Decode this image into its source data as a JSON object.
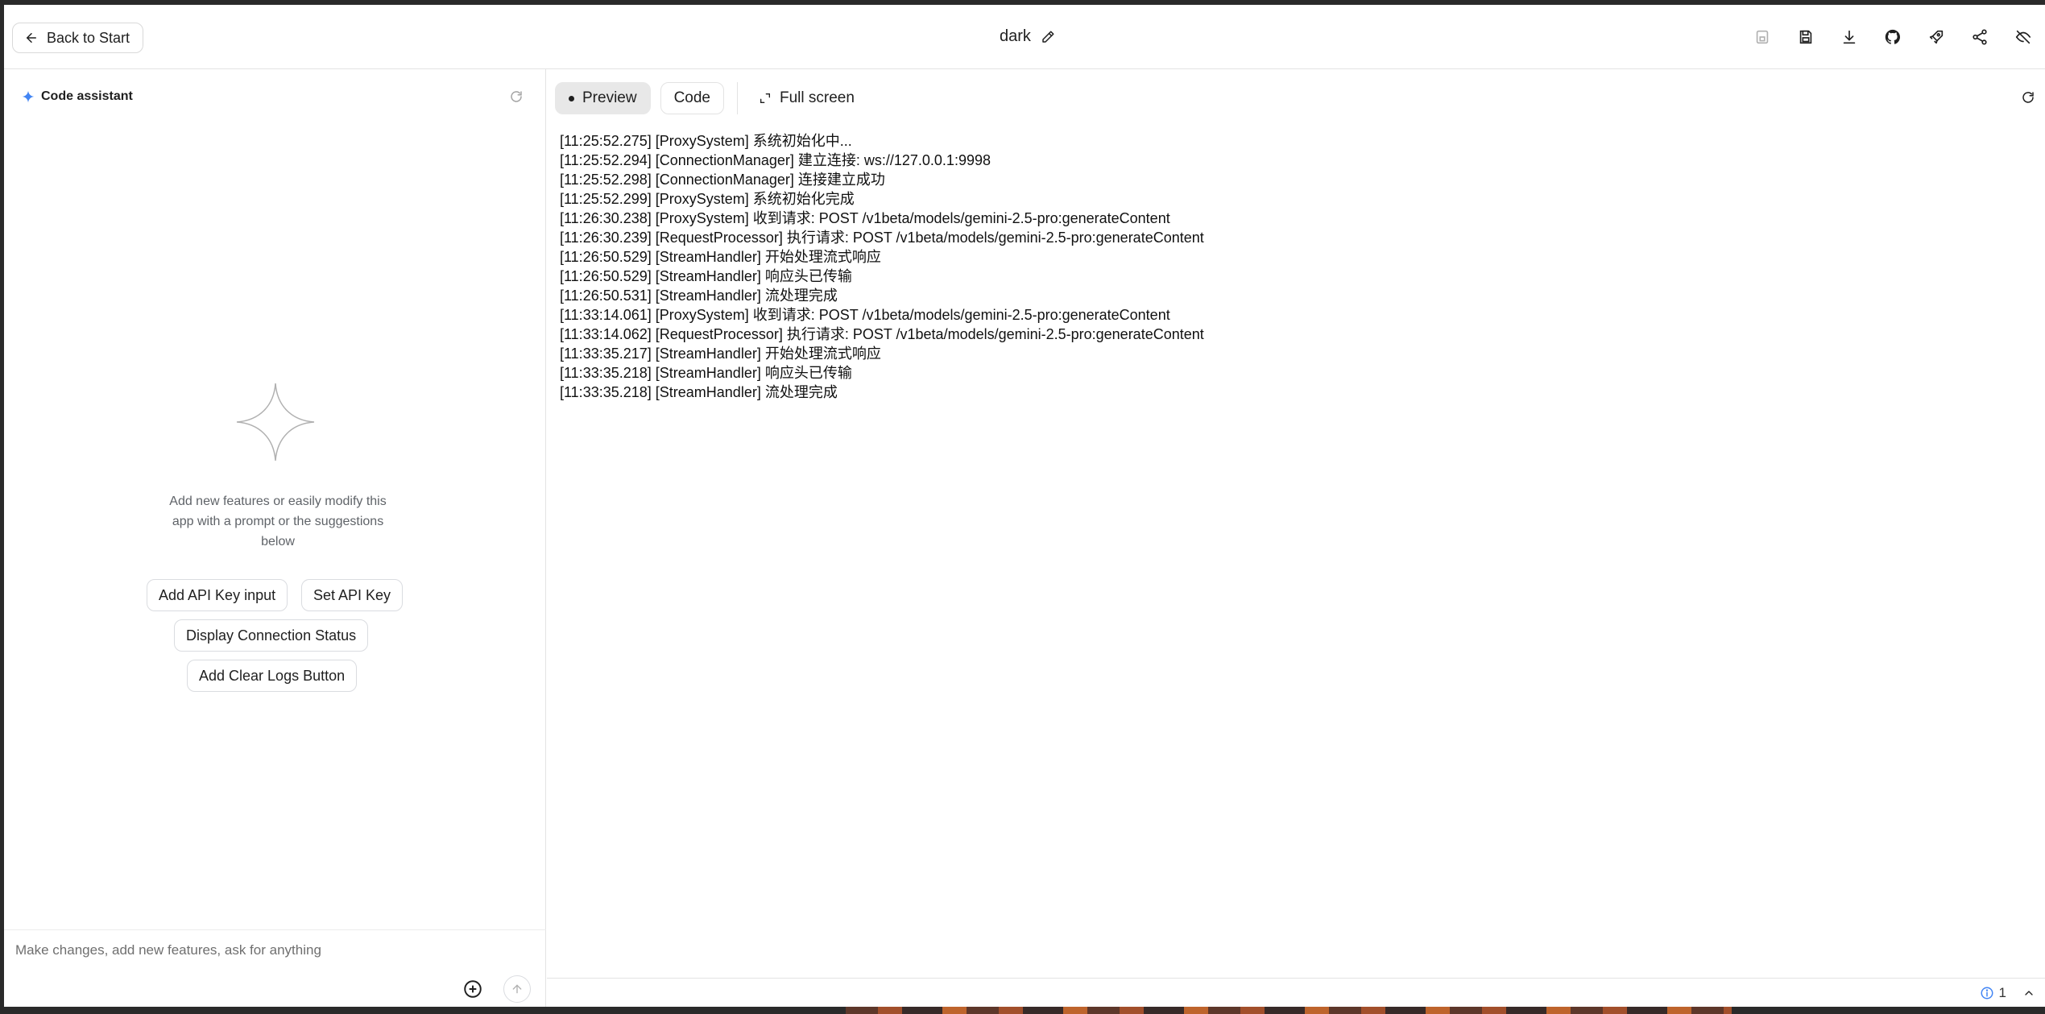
{
  "header": {
    "back_label": "Back to Start",
    "app_title": "dark",
    "actions": [
      "save-disabled-icon",
      "save-icon",
      "download-icon",
      "github-icon",
      "deploy-rocket-icon",
      "share-icon",
      "hide-icon"
    ]
  },
  "assistant": {
    "title": "Code assistant",
    "hint": "Add new features or easily modify this app with a prompt or the suggestions below",
    "suggestions": [
      "Add API Key input",
      "Set API Key",
      "Display Connection Status",
      "Add Clear Logs Button"
    ],
    "prompt_placeholder": "Make changes, add new features, ask for anything"
  },
  "preview": {
    "tabs": [
      "Preview",
      "Code"
    ],
    "active_tab": "Preview",
    "fullscreen_label": "Full screen",
    "logs": [
      "[11:25:52.275] [ProxySystem] 系统初始化中...",
      "[11:25:52.294] [ConnectionManager] 建立连接: ws://127.0.0.1:9998",
      "[11:25:52.298] [ConnectionManager] 连接建立成功",
      "[11:25:52.299] [ProxySystem] 系统初始化完成",
      "[11:26:30.238] [ProxySystem] 收到请求: POST /v1beta/models/gemini-2.5-pro:generateContent",
      "[11:26:30.239] [RequestProcessor] 执行请求: POST /v1beta/models/gemini-2.5-pro:generateContent",
      "[11:26:50.529] [StreamHandler] 开始处理流式响应",
      "[11:26:50.529] [StreamHandler] 响应头已传输",
      "[11:26:50.531] [StreamHandler] 流处理完成",
      "[11:33:14.061] [ProxySystem] 收到请求: POST /v1beta/models/gemini-2.5-pro:generateContent",
      "[11:33:14.062] [RequestProcessor] 执行请求: POST /v1beta/models/gemini-2.5-pro:generateContent",
      "[11:33:35.217] [StreamHandler] 开始处理流式响应",
      "[11:33:35.218] [StreamHandler] 响应头已传输",
      "[11:33:35.218] [StreamHandler] 流处理完成"
    ]
  },
  "status": {
    "count": "1"
  },
  "colors": {
    "accent": "#4285f4",
    "border": "#e3e3e3",
    "active_tab_bg": "#e8e8e8"
  }
}
